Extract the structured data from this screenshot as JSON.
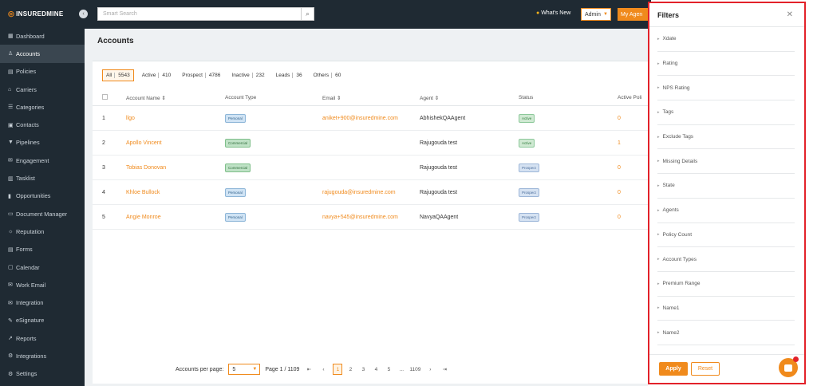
{
  "brand": {
    "name": "INSUREDMINE"
  },
  "sidebar": {
    "items": [
      {
        "label": "Dashboard",
        "icon": "dashboard-icon",
        "glyph": "▦"
      },
      {
        "label": "Accounts",
        "icon": "accounts-icon",
        "glyph": "♙",
        "active": true
      },
      {
        "label": "Policies",
        "icon": "policies-icon",
        "glyph": "▤"
      },
      {
        "label": "Carriers",
        "icon": "carriers-icon",
        "glyph": "⌂"
      },
      {
        "label": "Categories",
        "icon": "categories-icon",
        "glyph": "☰"
      },
      {
        "label": "Contacts",
        "icon": "contacts-icon",
        "glyph": "▣"
      },
      {
        "label": "Pipelines",
        "icon": "pipelines-icon",
        "glyph": "▼"
      },
      {
        "label": "Engagement",
        "icon": "engagement-icon",
        "glyph": "✉"
      },
      {
        "label": "Tasklist",
        "icon": "tasklist-icon",
        "glyph": "▥"
      },
      {
        "label": "Opportunities",
        "icon": "opportunities-icon",
        "glyph": "▮"
      },
      {
        "label": "Document Manager",
        "icon": "folder-icon",
        "glyph": "▭"
      },
      {
        "label": "Reputation",
        "icon": "reputation-icon",
        "glyph": "☼"
      },
      {
        "label": "Forms",
        "icon": "forms-icon",
        "glyph": "▤"
      },
      {
        "label": "Calendar",
        "icon": "calendar-icon",
        "glyph": "▢"
      },
      {
        "label": "Work Email",
        "icon": "email-icon",
        "glyph": "✉"
      },
      {
        "label": "Integration",
        "icon": "integration-icon",
        "glyph": "✉"
      },
      {
        "label": "eSignature",
        "icon": "signature-icon",
        "glyph": "✎"
      },
      {
        "label": "Reports",
        "icon": "reports-icon",
        "glyph": "↗"
      },
      {
        "label": "Integrations",
        "icon": "integrations-icon",
        "glyph": "⚙"
      },
      {
        "label": "Settings",
        "icon": "settings-icon",
        "glyph": "⚙"
      }
    ]
  },
  "topbar": {
    "search_placeholder": "Smart Search",
    "whats_new": "What's New",
    "admin_select": "Admin",
    "my_agency": "My Agen"
  },
  "page": {
    "title": "Accounts"
  },
  "tabs": [
    {
      "label": "All",
      "count": "5543",
      "active": true
    },
    {
      "label": "Active",
      "count": "410"
    },
    {
      "label": "Prospect",
      "count": "4786"
    },
    {
      "label": "Inactive",
      "count": "232"
    },
    {
      "label": "Leads",
      "count": "36"
    },
    {
      "label": "Others",
      "count": "60"
    }
  ],
  "table": {
    "headers": {
      "name": "Account Name ⇕",
      "type": "Account Type",
      "email": "Email ⇕",
      "agent": "Agent ⇕",
      "status": "Status",
      "policies": "Active Poli"
    },
    "rows": [
      {
        "idx": "1",
        "name": "llgo",
        "type": "Personal",
        "type_class": "personal",
        "email": "aniket+900@insuredmine.com",
        "agent": "AbhishekQAAgent",
        "status": "Active",
        "status_class": "active",
        "policies": "0"
      },
      {
        "idx": "2",
        "name": "Apollo Vincent",
        "type": "Commercial",
        "type_class": "commercial",
        "email": "",
        "agent": "Rajugouda test",
        "status": "Active",
        "status_class": "active",
        "policies": "1"
      },
      {
        "idx": "3",
        "name": "Tobias Donovan",
        "type": "Commercial",
        "type_class": "commercial",
        "email": "",
        "agent": "Rajugouda test",
        "status": "Prospect",
        "status_class": "prospect",
        "policies": "0"
      },
      {
        "idx": "4",
        "name": "Khloe Bullock",
        "type": "Personal",
        "type_class": "personal",
        "email": "rajugouda@insuredmine.com",
        "agent": "Rajugouda test",
        "status": "Prospect",
        "status_class": "prospect",
        "policies": "0"
      },
      {
        "idx": "5",
        "name": "Angie Monroe",
        "type": "Personal",
        "type_class": "personal",
        "email": "navya+545@insuredmine.com",
        "agent": "NavyaQAAgent",
        "status": "Prospect",
        "status_class": "prospect",
        "policies": "0"
      }
    ]
  },
  "pager": {
    "label": "Accounts per page:",
    "per_page": "5",
    "page_info": "Page 1 / 1109",
    "first": "⇤",
    "prev": "‹",
    "pages": [
      "1",
      "2",
      "3",
      "4",
      "5",
      "...",
      "1109"
    ],
    "current": "1",
    "next": "›",
    "last": "⇥"
  },
  "filters": {
    "title": "Filters",
    "items": [
      "Xdate",
      "Rating",
      "NPS Rating",
      "Tags",
      "Exclude Tags",
      "Missing Details",
      "State",
      "Agents",
      "Policy Count",
      "Account Types",
      "Premium Range",
      "Name1",
      "Name2"
    ],
    "apply": "Apply",
    "reset": "Reset"
  },
  "colors": {
    "accent": "#f08a1c",
    "sidebar": "#1f2a33",
    "highlight": "#e2222a"
  }
}
